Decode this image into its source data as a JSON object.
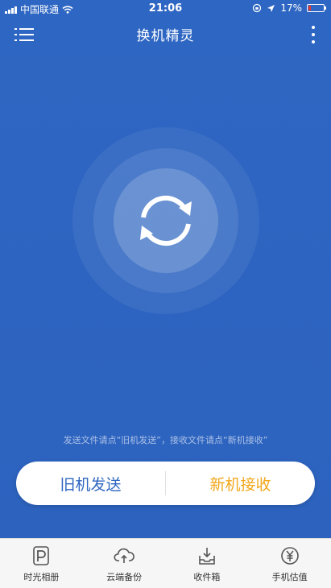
{
  "status_bar": {
    "carrier": "中国联通",
    "time": "21:06",
    "battery_percent": "17%",
    "battery_level": 0.17,
    "battery_color": "#e53935"
  },
  "header": {
    "title": "换机精灵",
    "menu_icon": "menu-icon",
    "more_icon": "more-vertical-icon"
  },
  "center": {
    "icon": "sync-icon"
  },
  "hint": "发送文件请点“旧机发送”，接收文件请点“新机接收”",
  "actions": {
    "old_send": "旧机发送",
    "new_receive": "新机接收",
    "old_color": "#2f66c1",
    "new_color": "#f2a81d"
  },
  "tabbar": {
    "items": [
      {
        "label": "时光相册",
        "icon": "album-icon"
      },
      {
        "label": "云端备份",
        "icon": "cloud-upload-icon"
      },
      {
        "label": "收件箱",
        "icon": "inbox-icon"
      },
      {
        "label": "手机估值",
        "icon": "yuan-icon"
      }
    ]
  },
  "colors": {
    "background": "#2f66c1",
    "tabbar": "#f6f6f6"
  }
}
